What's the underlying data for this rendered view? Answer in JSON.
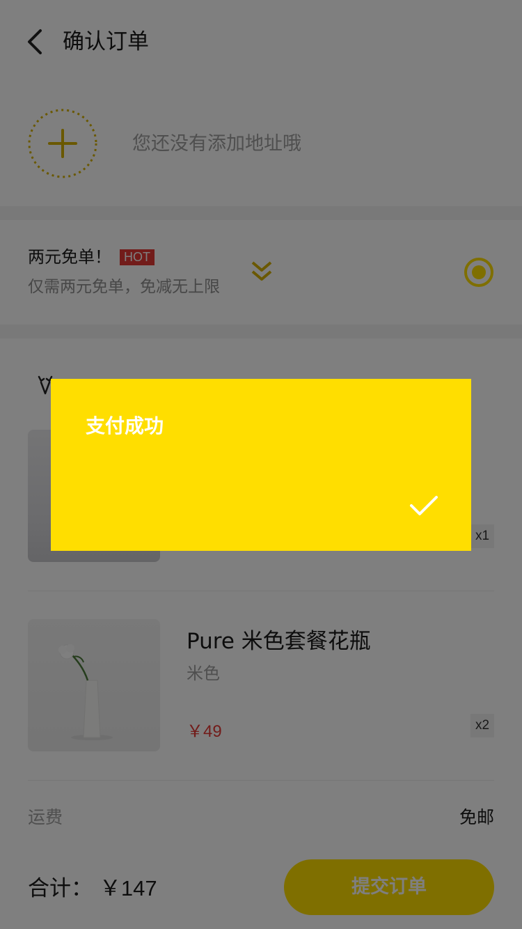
{
  "header": {
    "title": "确认订单"
  },
  "address": {
    "empty_text": "您还没有添加地址哦"
  },
  "promo": {
    "title": "两元免单！",
    "badge": "HOT",
    "subtitle": "仅需两元免单，免减无上限"
  },
  "products": [
    {
      "quantity": "x1"
    },
    {
      "name": "Pure 米色套餐花瓶",
      "spec": "米色",
      "price": "￥49",
      "quantity": "x2"
    }
  ],
  "shipping": {
    "label": "运费",
    "value": "免邮"
  },
  "footer": {
    "total_label": "合计：",
    "total_amount": "￥147",
    "submit_label": "提交订单"
  },
  "toast": {
    "title": "支付成功"
  },
  "colors": {
    "accent": "#ffde00",
    "price": "#e53935",
    "hot_badge": "#e53935",
    "overlay": "rgba(0,0,0,0.5)"
  }
}
